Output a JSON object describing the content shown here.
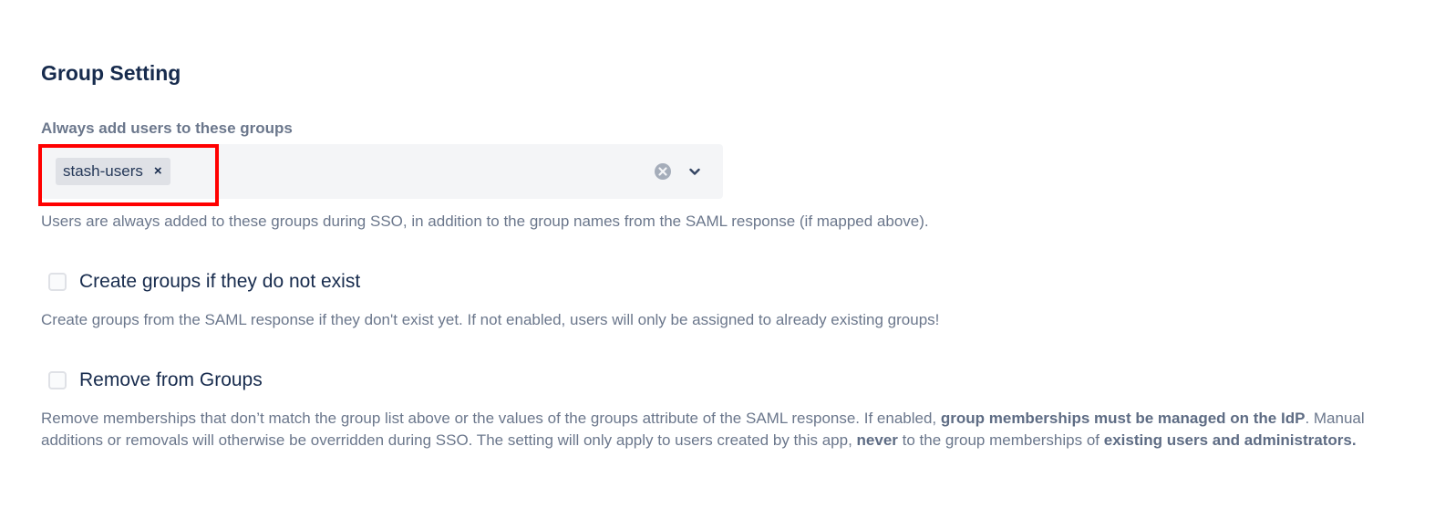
{
  "section": {
    "title": "Group Setting"
  },
  "groups_field": {
    "label": "Always add users to these groups",
    "selected": [
      {
        "label": "stash-users",
        "remove_glyph": "×"
      }
    ],
    "clear_icon": "clear-circle-icon",
    "dropdown_icon": "chevron-down-icon",
    "help": "Users are always added to these groups during SSO, in addition to the group names from the SAML response (if mapped above)."
  },
  "create_groups": {
    "label": "Create groups if they do not exist",
    "checked": false,
    "help": "Create groups from the SAML response if they don't exist yet. If not enabled, users will only be assigned to already existing groups!"
  },
  "remove_groups": {
    "label": "Remove from Groups",
    "checked": false,
    "help_part1": "Remove memberships that don’t match the group list above or the values of the groups attribute of the SAML response. If enabled, ",
    "help_bold1": "group memberships must be managed on the IdP",
    "help_part2": ". Manual additions or removals will otherwise be overridden during SSO. The setting will only apply to users created by this app, ",
    "help_bold2": "never",
    "help_part3": " to the group memberships of ",
    "help_bold3": "existing users and administrators."
  },
  "colors": {
    "highlight": "#ff0000",
    "heading": "#172b4d",
    "muted": "#6b778c",
    "field_bg": "#f4f5f7",
    "chip_bg": "#dfe1e6"
  }
}
